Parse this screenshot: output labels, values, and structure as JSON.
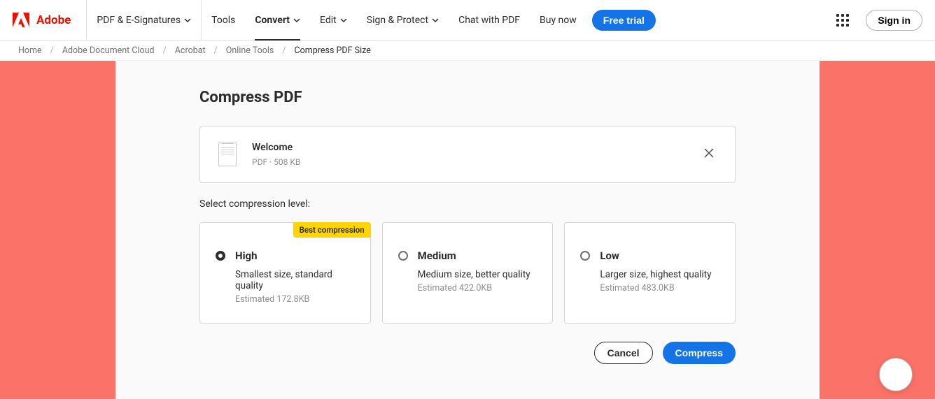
{
  "brand": {
    "name": "Adobe"
  },
  "nav": {
    "items": [
      {
        "label": "PDF & E-Signatures",
        "dropdown": true
      },
      {
        "label": "Tools",
        "dropdown": false
      },
      {
        "label": "Convert",
        "dropdown": true,
        "active": true
      },
      {
        "label": "Edit",
        "dropdown": true
      },
      {
        "label": "Sign & Protect",
        "dropdown": true
      },
      {
        "label": "Chat with PDF",
        "dropdown": false
      },
      {
        "label": "Buy now",
        "dropdown": false
      }
    ],
    "free_trial": "Free trial",
    "sign_in": "Sign in"
  },
  "breadcrumb": {
    "items": [
      "Home",
      "Adobe Document Cloud",
      "Acrobat",
      "Online Tools"
    ],
    "current": "Compress PDF Size"
  },
  "page": {
    "title": "Compress PDF",
    "file": {
      "name": "Welcome",
      "meta": "PDF · 508 KB"
    },
    "section_label": "Select compression level:",
    "options": [
      {
        "title": "High",
        "desc": "Smallest size, standard quality",
        "estimated": "Estimated 172.8KB",
        "badge": "Best compression",
        "selected": true
      },
      {
        "title": "Medium",
        "desc": "Medium size, better quality",
        "estimated": "Estimated 422.0KB",
        "selected": false
      },
      {
        "title": "Low",
        "desc": "Larger size, highest quality",
        "estimated": "Estimated 483.0KB",
        "selected": false
      }
    ],
    "actions": {
      "cancel": "Cancel",
      "compress": "Compress"
    }
  }
}
